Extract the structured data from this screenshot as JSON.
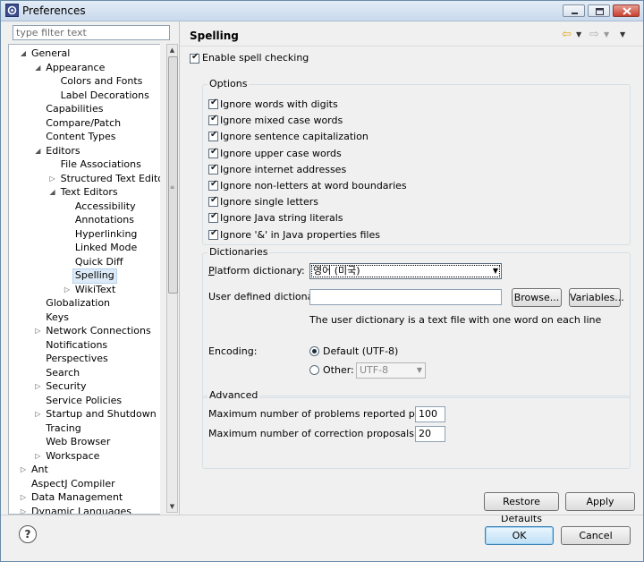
{
  "window": {
    "title": "Preferences"
  },
  "filter": {
    "placeholder": "type filter text"
  },
  "tree": [
    {
      "label": "General",
      "toggle": "open"
    },
    {
      "label": "Appearance",
      "toggle": "open"
    },
    {
      "label": "Colors and Fonts",
      "toggle": ""
    },
    {
      "label": "Label Decorations",
      "toggle": ""
    },
    {
      "label": "Capabilities",
      "toggle": ""
    },
    {
      "label": "Compare/Patch",
      "toggle": ""
    },
    {
      "label": "Content Types",
      "toggle": ""
    },
    {
      "label": "Editors",
      "toggle": "open"
    },
    {
      "label": "File Associations",
      "toggle": ""
    },
    {
      "label": "Structured Text Editors",
      "toggle": "closed"
    },
    {
      "label": "Text Editors",
      "toggle": "open"
    },
    {
      "label": "Accessibility",
      "toggle": ""
    },
    {
      "label": "Annotations",
      "toggle": ""
    },
    {
      "label": "Hyperlinking",
      "toggle": ""
    },
    {
      "label": "Linked Mode",
      "toggle": ""
    },
    {
      "label": "Quick Diff",
      "toggle": ""
    },
    {
      "label": "Spelling",
      "toggle": "",
      "selected": true
    },
    {
      "label": "WikiText",
      "toggle": "closed"
    },
    {
      "label": "Globalization",
      "toggle": ""
    },
    {
      "label": "Keys",
      "toggle": ""
    },
    {
      "label": "Network Connections",
      "toggle": "closed"
    },
    {
      "label": "Notifications",
      "toggle": ""
    },
    {
      "label": "Perspectives",
      "toggle": ""
    },
    {
      "label": "Search",
      "toggle": ""
    },
    {
      "label": "Security",
      "toggle": "closed"
    },
    {
      "label": "Service Policies",
      "toggle": ""
    },
    {
      "label": "Startup and Shutdown",
      "toggle": "closed"
    },
    {
      "label": "Tracing",
      "toggle": ""
    },
    {
      "label": "Web Browser",
      "toggle": ""
    },
    {
      "label": "Workspace",
      "toggle": "closed"
    },
    {
      "label": "Ant",
      "toggle": "closed"
    },
    {
      "label": "AspectJ Compiler",
      "toggle": ""
    },
    {
      "label": "Data Management",
      "toggle": "closed"
    },
    {
      "label": "Dynamic Languages",
      "toggle": "closed"
    }
  ],
  "page": {
    "title": "Spelling",
    "enable_label": "Enable spell checking",
    "enable_checked": true,
    "options_title": "Options",
    "options": [
      "Ignore words with digits",
      "Ignore mixed case words",
      "Ignore sentence capitalization",
      "Ignore upper case words",
      "Ignore internet addresses",
      "Ignore non-letters at word boundaries",
      "Ignore single letters",
      "Ignore Java string literals",
      "Ignore '&' in Java properties files"
    ],
    "dictionaries_title": "Dictionaries",
    "platform_dictionary_label": "Platform dictionary:",
    "platform_dictionary_value": "영어 (미국)",
    "user_dictionary_label": "User defined dictionary:",
    "user_dictionary_value": "",
    "browse_label": "Browse...",
    "variables_label": "Variables...",
    "user_dictionary_hint": "The user dictionary is a text file with one word on each line",
    "encoding_label": "Encoding:",
    "encoding_default_label": "Default (UTF-8)",
    "encoding_other_label": "Other:",
    "encoding_other_value": "UTF-8",
    "encoding_default_selected": true,
    "advanced_title": "Advanced",
    "max_problems_label": "Maximum number of problems reported per file:",
    "max_problems_value": "100",
    "max_proposals_label": "Maximum number of correction proposals:",
    "max_proposals_value": "20",
    "restore_defaults_label": "Restore Defaults",
    "apply_label": "Apply"
  },
  "footer": {
    "help_glyph": "?",
    "ok_label": "OK",
    "cancel_label": "Cancel"
  },
  "icons": {
    "app": "preferences-gear-icon",
    "back": "back-arrow-icon",
    "forward": "forward-arrow-icon",
    "menu": "view-menu-icon"
  },
  "colors": {
    "selection": "#ddebf8",
    "accent": "#3c7fb1",
    "nav_arrow": "#e0a21a"
  }
}
